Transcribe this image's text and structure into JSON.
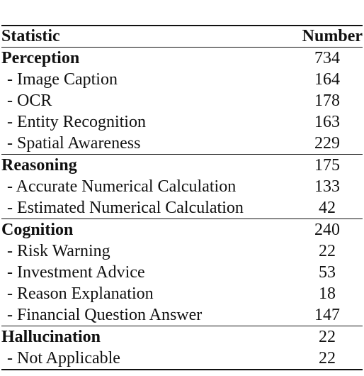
{
  "table": {
    "headers": {
      "statistic": "Statistic",
      "number": "Number"
    },
    "groups": [
      {
        "category": "Perception",
        "total": "734",
        "items": [
          {
            "label": "- Image Caption",
            "value": "164"
          },
          {
            "label": "- OCR",
            "value": "178"
          },
          {
            "label": "- Entity Recognition",
            "value": "163"
          },
          {
            "label": "- Spatial Awareness",
            "value": "229"
          }
        ]
      },
      {
        "category": "Reasoning",
        "total": "175",
        "items": [
          {
            "label": "- Accurate Numerical Calculation",
            "value": "133"
          },
          {
            "label": "- Estimated Numerical Calculation",
            "value": "42"
          }
        ]
      },
      {
        "category": "Cognition",
        "total": "240",
        "items": [
          {
            "label": "- Risk Warning",
            "value": "22"
          },
          {
            "label": "- Investment Advice",
            "value": "53"
          },
          {
            "label": "- Reason Explanation",
            "value": "18"
          },
          {
            "label": "- Financial Question Answer",
            "value": "147"
          }
        ]
      },
      {
        "category": "Hallucination",
        "total": "22",
        "items": [
          {
            "label": "- Not Applicable",
            "value": "22"
          }
        ]
      }
    ]
  }
}
